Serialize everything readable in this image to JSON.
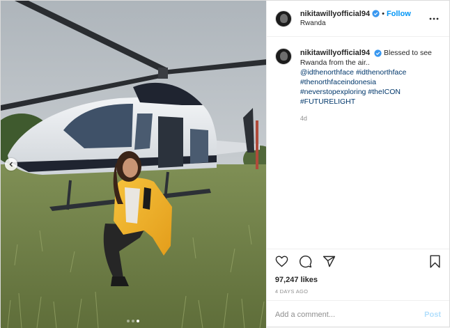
{
  "post": {
    "username": "nikitawillyofficial94",
    "location": "Rwanda",
    "follow_label": "Follow",
    "separator": "•",
    "caption": {
      "text": "Blessed to see Rwanda from the air..",
      "tags": [
        "@idthenorthface",
        "#idthenorthface",
        "#thenorthfaceindonesia",
        "#neverstopexploring",
        "#theICON",
        "#FUTURELIGHT"
      ]
    },
    "relative_time": "4d",
    "likes": "97,247 likes",
    "posted_ago": "4 DAYS AGO",
    "comment": {
      "placeholder": "Add a comment...",
      "post_label": "Post"
    },
    "carousel": {
      "count": 3,
      "active_index": 2
    }
  },
  "icons": {
    "more": "more-options-icon",
    "verified": "verified-badge-icon",
    "like": "heart-icon",
    "comment": "comment-icon",
    "share": "paper-plane-icon",
    "save": "bookmark-icon",
    "prev": "chevron-left-icon"
  },
  "colors": {
    "link": "#0095f6",
    "tag": "#00376b",
    "muted": "#8e8e8e",
    "jacket": "#f0b52a"
  }
}
